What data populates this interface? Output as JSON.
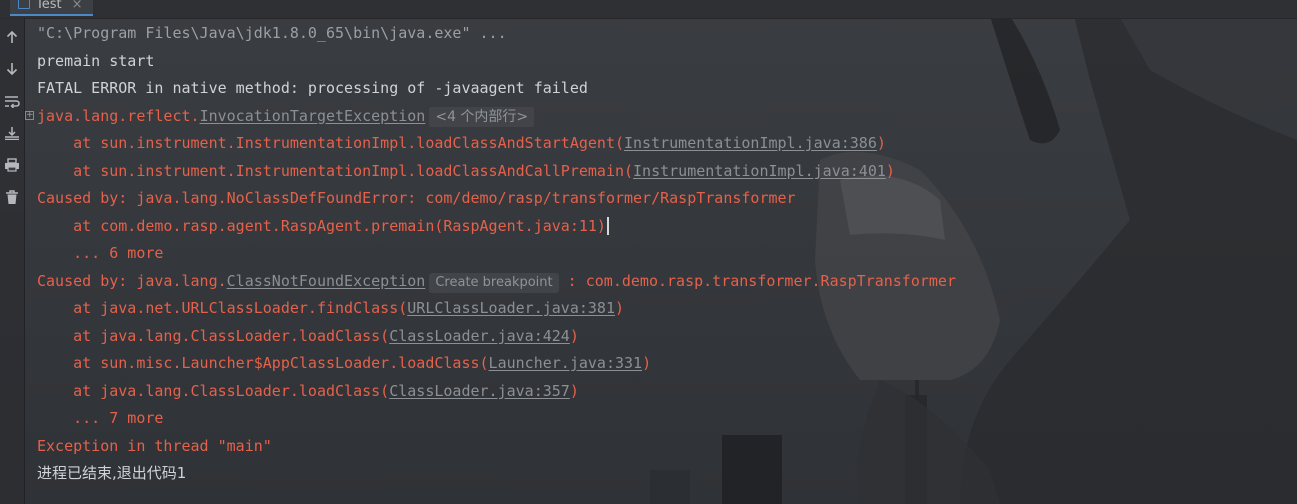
{
  "tab": {
    "title": "Test",
    "close_glyph": "×"
  },
  "toolbar": {
    "icons": [
      "arrow-up-icon",
      "arrow-down-icon",
      "soft-wrap-icon",
      "scroll-to-end-icon",
      "print-icon",
      "trash-icon"
    ]
  },
  "console": {
    "lines": [
      {
        "parts": [
          {
            "text": "\"C:\\Program Files\\Java\\jdk1.8.0_65\\bin\\java.exe\" ...",
            "style": "muted"
          }
        ]
      },
      {
        "parts": [
          {
            "text": "premain start",
            "style": "normal"
          }
        ]
      },
      {
        "parts": [
          {
            "text": "FATAL ERROR in native method: processing of -javaagent failed",
            "style": "normal"
          }
        ]
      },
      {
        "parts": [
          {
            "text": "java.lang.reflect.",
            "style": "err"
          },
          {
            "text": "InvocationTargetException",
            "style": "link"
          },
          {
            "text": "<4 个内部行>",
            "style": "fold"
          }
        ]
      },
      {
        "parts": [
          {
            "text": "    at sun.instrument.InstrumentationImpl.loadClassAndStartAgent(",
            "style": "err"
          },
          {
            "text": "InstrumentationImpl.java:386",
            "style": "link"
          },
          {
            "text": ")",
            "style": "err"
          }
        ]
      },
      {
        "parts": [
          {
            "text": "    at sun.instrument.InstrumentationImpl.loadClassAndCallPremain(",
            "style": "err"
          },
          {
            "text": "InstrumentationImpl.java:401",
            "style": "link"
          },
          {
            "text": ")",
            "style": "err"
          }
        ]
      },
      {
        "parts": [
          {
            "text": "Caused by: java.lang.NoClassDefFoundError: com/demo/rasp/transformer/RaspTransformer",
            "style": "err"
          }
        ]
      },
      {
        "parts": [
          {
            "text": "    at com.demo.rasp.agent.RaspAgent.premain(RaspAgent.java:11)",
            "style": "err"
          },
          {
            "text": "",
            "style": "caret"
          }
        ]
      },
      {
        "parts": [
          {
            "text": "    ... 6 more",
            "style": "err"
          }
        ]
      },
      {
        "parts": [
          {
            "text": "Caused by: java.lang.",
            "style": "err"
          },
          {
            "text": "ClassNotFoundException",
            "style": "link"
          },
          {
            "text": "Create breakpoint",
            "style": "hint"
          },
          {
            "text": " : com.demo.rasp.transformer.RaspTransformer",
            "style": "err"
          }
        ]
      },
      {
        "parts": [
          {
            "text": "    at java.net.URLClassLoader.findClass(",
            "style": "err"
          },
          {
            "text": "URLClassLoader.java:381",
            "style": "link"
          },
          {
            "text": ")",
            "style": "err"
          }
        ]
      },
      {
        "parts": [
          {
            "text": "    at java.lang.ClassLoader.loadClass(",
            "style": "err"
          },
          {
            "text": "ClassLoader.java:424",
            "style": "link"
          },
          {
            "text": ")",
            "style": "err"
          }
        ]
      },
      {
        "parts": [
          {
            "text": "    at sun.misc.Launcher$AppClassLoader.loadClass(",
            "style": "err"
          },
          {
            "text": "Launcher.java:331",
            "style": "link"
          },
          {
            "text": ")",
            "style": "err"
          }
        ]
      },
      {
        "parts": [
          {
            "text": "    at java.lang.ClassLoader.loadClass(",
            "style": "err"
          },
          {
            "text": "ClassLoader.java:357",
            "style": "link"
          },
          {
            "text": ")",
            "style": "err"
          }
        ]
      },
      {
        "parts": [
          {
            "text": "    ... 7 more",
            "style": "err"
          }
        ]
      },
      {
        "parts": [
          {
            "text": "Exception in thread \"main\"",
            "style": "err"
          }
        ]
      },
      {
        "parts": [
          {
            "text": "进程已结束,退出代码1",
            "style": "normal"
          }
        ]
      }
    ]
  }
}
